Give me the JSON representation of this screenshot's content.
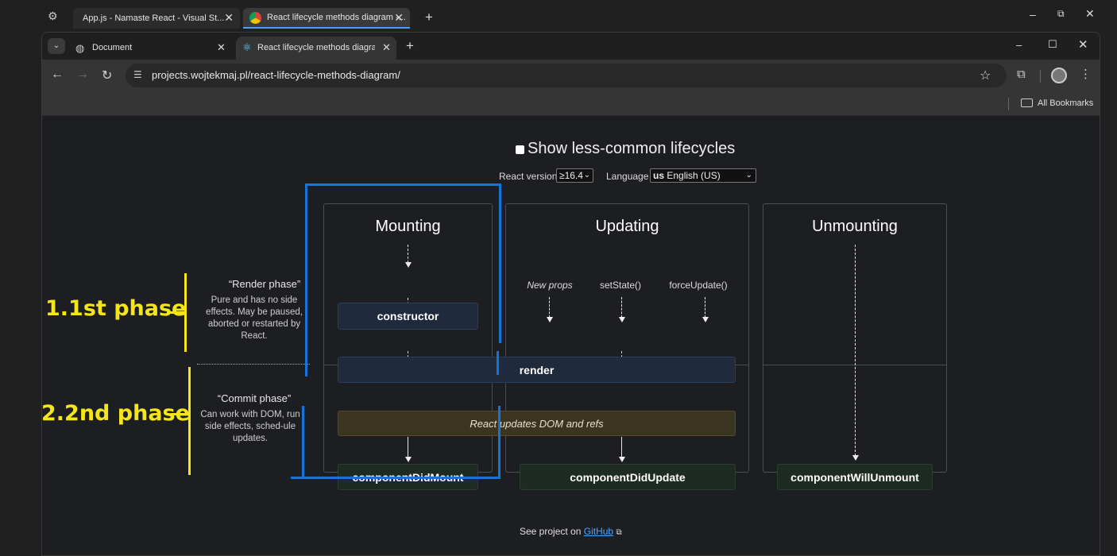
{
  "outer": {
    "tabs": [
      {
        "label": "App.js - Namaste React - Visual St..."
      },
      {
        "label": "React lifecycle methods diagram -..."
      }
    ]
  },
  "browser": {
    "tabs": [
      {
        "label": "Document"
      },
      {
        "label": "React lifecycle methods diagram"
      }
    ],
    "url": "projects.wojtekmaj.pl/react-lifecycle-methods-diagram/",
    "bookmarks_label": "All Bookmarks"
  },
  "page": {
    "toggle_label": "Show less-common lifecycles",
    "react_version_label": "React version",
    "react_version_value": "≥16.4",
    "language_label": "Language",
    "language_flag": "us",
    "language_value": "English (US)",
    "columns": {
      "mounting": "Mounting",
      "updating": "Updating",
      "unmounting": "Unmounting"
    },
    "render_phase": {
      "title": "“Render phase”",
      "desc": "Pure and has no side effects. May be paused, aborted or restarted by React."
    },
    "commit_phase": {
      "title": "“Commit phase”",
      "desc": "Can work with DOM, run side effects, sched-ule updates."
    },
    "boxes": {
      "constructor": "constructor",
      "render": "render",
      "dom_updates": "React updates DOM and refs",
      "did_mount": "componentDidMount",
      "did_update": "componentDidUpdate",
      "will_unmount": "componentWillUnmount"
    },
    "triggers": {
      "new_props": "New props",
      "set_state": "setState()",
      "force_update": "forceUpdate()"
    },
    "footer_prefix": "See project on",
    "footer_link": "GitHub"
  },
  "annotations": {
    "first": "1.1st phase",
    "second": "2.2nd phase"
  },
  "colors": {
    "annotation_yellow": "#f5e51a",
    "annotation_blue": "#1574d8",
    "link_blue": "#4da3ff"
  }
}
